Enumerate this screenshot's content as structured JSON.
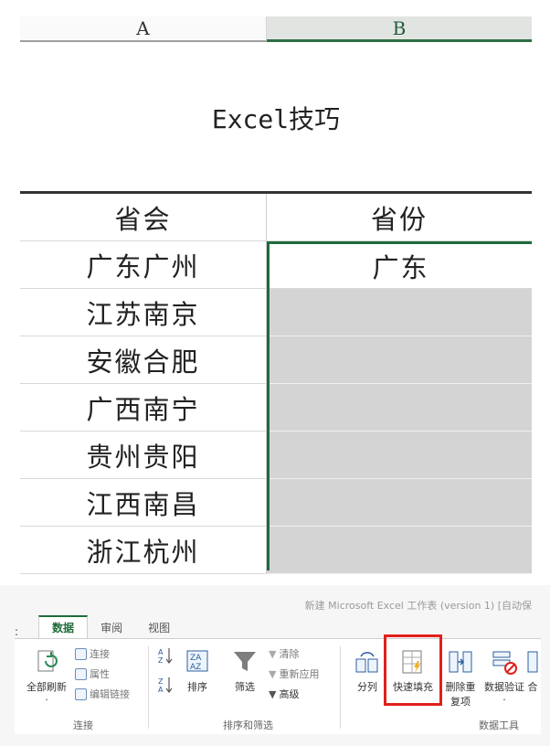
{
  "sheet": {
    "col_a": "A",
    "col_b": "B",
    "title": "Excel技巧",
    "header": {
      "a": "省会",
      "b": "省份"
    },
    "rows": [
      {
        "a": "广东广州",
        "b": "广东"
      },
      {
        "a": "江苏南京",
        "b": ""
      },
      {
        "a": "安徽合肥",
        "b": ""
      },
      {
        "a": "广西南宁",
        "b": ""
      },
      {
        "a": "贵州贵阳",
        "b": ""
      },
      {
        "a": "江西南昌",
        "b": ""
      },
      {
        "a": "浙江杭州",
        "b": ""
      }
    ]
  },
  "ribbon": {
    "window_title": "新建 Microsoft Excel 工作表 (version 1) [自动保",
    "tab_marker": ":",
    "tabs": [
      "数据",
      "审阅",
      "视图"
    ],
    "active_tab": "数据",
    "refresh_all": "全部刷新",
    "refresh_arrow": "·",
    "conn_items": [
      "连接",
      "属性",
      "编辑链接"
    ],
    "group_connect": "连接",
    "sort_label": "排序",
    "filter_label": "筛选",
    "filter_items": [
      "清除",
      "重新应用",
      "高级"
    ],
    "group_sort_filter": "排序和筛选",
    "split_label": "分列",
    "flash_fill_label": "快速填充",
    "remove_dup_label": "删除重复项",
    "validation_label": "数据验证·",
    "more_label": "合",
    "group_data_tools": "数据工具",
    "accent": "#1e6b3a",
    "highlight": "#e0201b"
  }
}
